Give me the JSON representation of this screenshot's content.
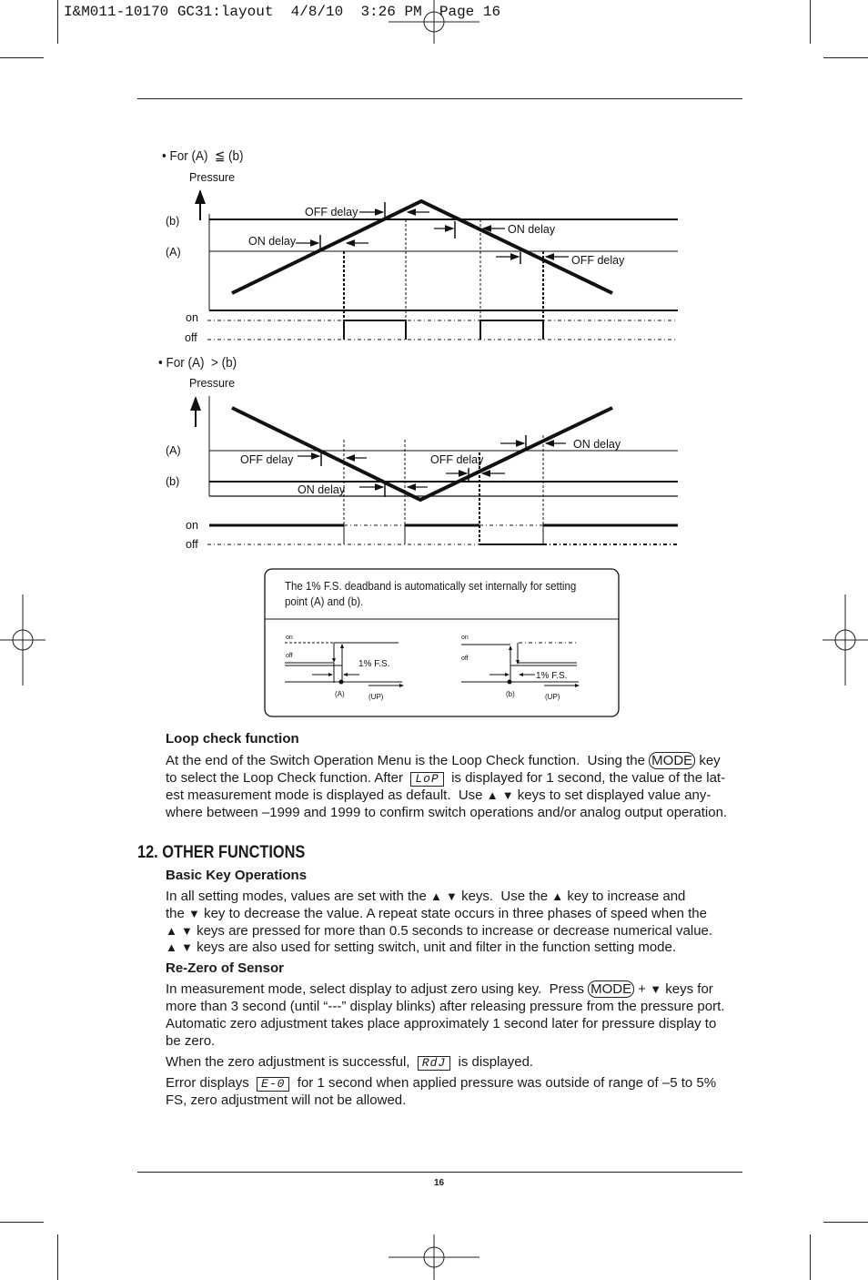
{
  "slug": "I&M011-10170 GC31:layout  4/8/10  3:26 PM  Page 16",
  "diagram1": {
    "heading": "• For (A)  ≦ (b)",
    "pressure": "Pressure",
    "b": "(b)",
    "a": "(A)",
    "on": "on",
    "off": "off",
    "off_delay_1": "OFF delay",
    "on_delay_1": "ON delay",
    "on_delay_2": "ON delay",
    "off_delay_2": "OFF delay"
  },
  "diagram2": {
    "heading": "• For (A)  > (b)",
    "pressure": "Pressure",
    "a": "(A)",
    "b": "(b)",
    "on": "on",
    "off": "off",
    "off_delay_1": "OFF delay",
    "on_delay_1": "ON delay",
    "off_delay_2": "OFF delay",
    "on_delay_2": "ON delay"
  },
  "deadband": {
    "text_line1": "The 1% F.S. deadband is automatically set internally for setting",
    "text_line2": "point (A) and (b).",
    "left": {
      "on": "on",
      "off": "off",
      "fs": "1% F.S.",
      "point": "(A)",
      "up": "(UP)"
    },
    "right": {
      "on": "on",
      "off": "off",
      "fs": "1% F.S.",
      "point": "(b)",
      "up": "(UP)"
    }
  },
  "loop_check": {
    "heading": "Loop check function",
    "lines": [
      [
        {
          "t": "At the end of the Switch Operation Menu is the Loop Check function.  Using the "
        },
        {
          "key": "MODE"
        },
        {
          "t": " key"
        }
      ],
      [
        {
          "t": "to select the Loop Check function. After  "
        },
        {
          "lcd": "LoP"
        },
        {
          "t": "  is displayed for 1 second, the value of the lat-"
        }
      ],
      [
        {
          "t": "est measurement mode is displayed as default.  Use "
        },
        {
          "icon": "up"
        },
        {
          "t": " "
        },
        {
          "icon": "down"
        },
        {
          "t": " keys to set displayed value any-"
        }
      ],
      [
        {
          "t": "where between –1999 and 1999 to confirm switch operations and/or analog output operation."
        }
      ]
    ]
  },
  "section_title": "12. OTHER FUNCTIONS",
  "basic_keys": {
    "heading": "Basic Key Operations",
    "lines": [
      [
        {
          "t": "In all setting modes, values are set with the "
        },
        {
          "icon": "up"
        },
        {
          "t": " "
        },
        {
          "icon": "down"
        },
        {
          "t": " keys.  Use the "
        },
        {
          "icon": "up"
        },
        {
          "t": " key to increase and"
        }
      ],
      [
        {
          "t": "the "
        },
        {
          "icon": "down"
        },
        {
          "t": " key to decrease the value. A repeat state occurs in three phases of speed when the"
        }
      ],
      [
        {
          "icon": "up"
        },
        {
          "t": " "
        },
        {
          "icon": "down"
        },
        {
          "t": " keys are pressed for more than 0.5 seconds to increase or decrease numerical value."
        }
      ],
      [
        {
          "icon": "up"
        },
        {
          "t": " "
        },
        {
          "icon": "down"
        },
        {
          "t": " keys are also used for setting switch, unit and filter in the function setting mode."
        }
      ]
    ]
  },
  "rezero": {
    "heading": "Re-Zero of Sensor",
    "lines": [
      [
        {
          "t": "In measurement mode, select display to adjust zero using key.  Press "
        },
        {
          "key": "MODE"
        },
        {
          "t": " + "
        },
        {
          "icon": "down"
        },
        {
          "t": " keys for"
        }
      ],
      [
        {
          "t": "more than 3 second (until “---” display blinks) after releasing pressure from the pressure port."
        }
      ],
      [
        {
          "t": "Automatic zero adjustment takes place approximately 1 second later for pressure display to"
        }
      ],
      [
        {
          "t": "be zero."
        }
      ],
      [
        {
          "t": "When the zero adjustment is successful,  "
        },
        {
          "lcd": "RdJ"
        },
        {
          "t": "  is displayed."
        }
      ],
      [
        {
          "t": "Error displays  "
        },
        {
          "lcd": "E-0"
        },
        {
          "t": "  for 1 second when applied pressure was outside of range of –5 to 5%"
        }
      ],
      [
        {
          "t": "FS, zero adjustment will not be allowed."
        }
      ]
    ]
  },
  "page_number": "16"
}
